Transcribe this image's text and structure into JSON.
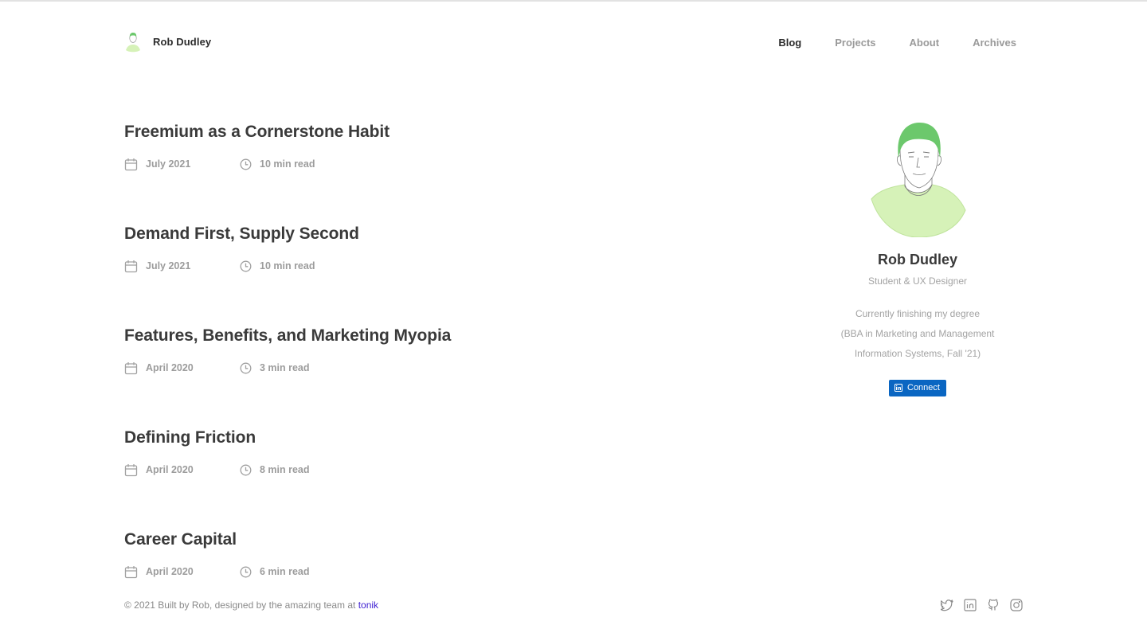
{
  "site": {
    "brand_name": "Rob Dudley"
  },
  "nav": {
    "items": [
      {
        "label": "Blog",
        "active": true
      },
      {
        "label": "Projects",
        "active": false
      },
      {
        "label": "About",
        "active": false
      },
      {
        "label": "Archives",
        "active": false
      }
    ]
  },
  "posts": [
    {
      "title": "Freemium as a Cornerstone Habit",
      "date": "July 2021",
      "read_time": "10 min read"
    },
    {
      "title": "Demand First, Supply Second",
      "date": "July 2021",
      "read_time": "10 min read"
    },
    {
      "title": "Features, Benefits, and Marketing Myopia",
      "date": "April 2020",
      "read_time": "3 min read"
    },
    {
      "title": "Defining Friction",
      "date": "April 2020",
      "read_time": "8 min read"
    },
    {
      "title": "Career Capital",
      "date": "April 2020",
      "read_time": "6 min read"
    }
  ],
  "profile": {
    "name": "Rob Dudley",
    "role": "Student & UX Designer",
    "bio_lines": [
      "Currently finishing my degree",
      "(BBA in Marketing and Management",
      "Information Systems, Fall '21)"
    ],
    "connect_label": "Connect"
  },
  "footer": {
    "text": "© 2021 Built by Rob, designed by the amazing team at ",
    "link_label": "tonik"
  },
  "social_icons": [
    "twitter-icon",
    "linkedin-icon",
    "github-icon",
    "instagram-icon"
  ],
  "colors": {
    "accent_green": "#6cc86c",
    "shirt_green": "#d6f2b8",
    "linkedin_blue": "#0a66c2",
    "link_purple": "#3d1fd1",
    "text_dark": "#3a3a3a",
    "text_muted": "#9c9c9c"
  }
}
